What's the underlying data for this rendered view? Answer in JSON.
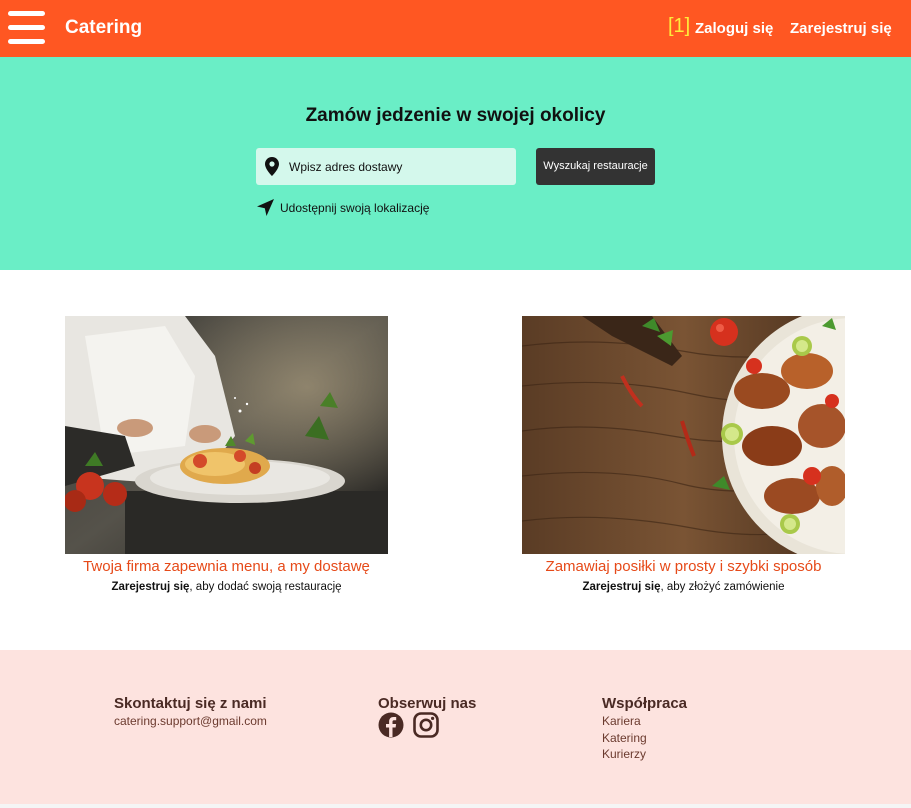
{
  "header": {
    "brand": "Catering",
    "marker": "[1]",
    "login": "Zaloguj się",
    "register": "Zarejestruj się",
    "icons": {
      "menu": "hamburger-menu-icon"
    },
    "colors": {
      "bar": "#ff5722",
      "text": "#ffffff",
      "marker": "#ffeb3b"
    }
  },
  "hero": {
    "title": "Zamów jedzenie w swojej okolicy",
    "address_placeholder": "Wpisz adres dostawy",
    "search_button": "Wyszukaj restauracje",
    "share_location": "Udostępnij swoją lokalizację",
    "icons": {
      "address": "location-pin-icon",
      "share": "navigation-arrow-icon"
    },
    "colors": {
      "background": "#6aeec6",
      "input": "#d4f8ec",
      "button": "#333333"
    }
  },
  "cards": [
    {
      "image": "chef plating pasta",
      "title": "Twoja firma zapewnia menu, a my dostawę",
      "link": "Zarejestruj się",
      "rest": ", aby dodać swoją restaurację"
    },
    {
      "image": "grilled chicken on wooden table",
      "title": "Zamawiaj posiłki w prosty i szybki sposób",
      "link": "Zarejestruj się",
      "rest": ", aby złożyć zamówienie"
    }
  ],
  "footer": {
    "contact_title": "Skontaktuj się z nami",
    "email": "catering.support@gmail.com",
    "follow_title": "Obserwuj nas",
    "social_icons": [
      "facebook-icon",
      "instagram-icon"
    ],
    "partner_title": "Współpraca",
    "partner_links": [
      "Kariera",
      "Katering",
      "Kurierzy"
    ],
    "colors": {
      "background": "#fde3df",
      "accent": "#e64a19"
    }
  }
}
